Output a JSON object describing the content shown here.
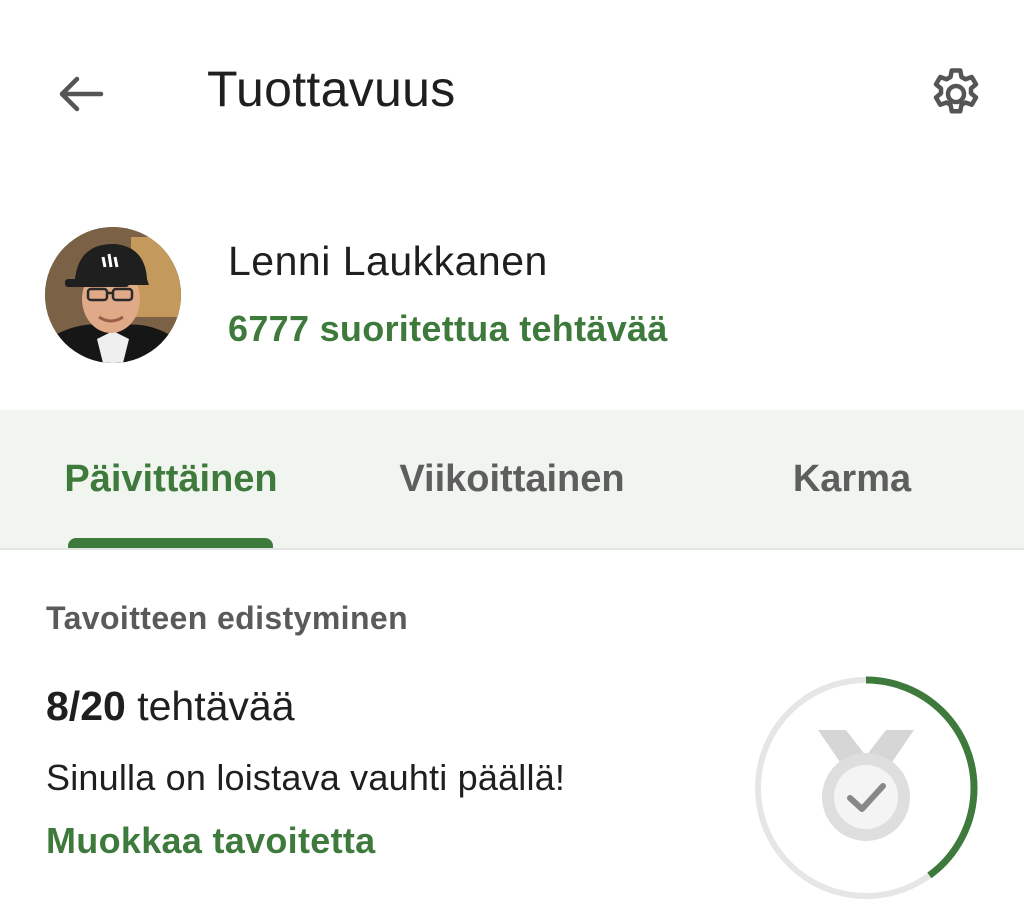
{
  "header": {
    "title": "Tuottavuus",
    "back_icon": "arrow-left-icon",
    "settings_icon": "gear-icon"
  },
  "profile": {
    "name": "Lenni Laukkanen",
    "completed_text": "6777 suoritettua tehtävää",
    "avatar_icon": "user-avatar-photo"
  },
  "tabs": [
    {
      "label": "Päivittäinen",
      "active": true
    },
    {
      "label": "Viikoittainen",
      "active": false
    },
    {
      "label": "Karma",
      "active": false
    }
  ],
  "goal": {
    "section_label": "Tavoitteen edistyminen",
    "done": "8/20",
    "unit": " tehtävää",
    "message": "Sinulla on loistava vauhti päällä!",
    "edit_label": "Muokkaa tavoitetta",
    "progress_fraction": 0.4,
    "medal_icon": "medal-check-icon"
  },
  "colors": {
    "accent": "#3f7a3d",
    "tab_bg": "#f1f5f0",
    "ring_track": "#e6e6e6",
    "medal": "#d9d9d9"
  }
}
